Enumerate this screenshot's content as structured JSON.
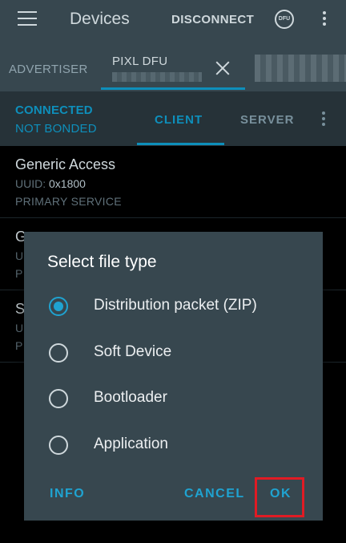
{
  "appbar": {
    "title": "Devices",
    "disconnect_label": "DISCONNECT",
    "dfu_icon_text": "DFU",
    "icons": [
      "menu-icon",
      "dfu-icon",
      "overflow-icon"
    ]
  },
  "tabs": {
    "advertiser_label": "ADVERTISER",
    "device_label": "PIXL DFU"
  },
  "status": {
    "connected": "CONNECTED",
    "bonded": "NOT BONDED",
    "client_tab": "CLIENT",
    "server_tab": "SERVER"
  },
  "services": [
    {
      "name": "Generic Access",
      "uuid_label": "UUID:",
      "uuid": "0x1800",
      "type": "PRIMARY SERVICE"
    },
    {
      "name": "G",
      "uuid_label": "U",
      "uuid": "",
      "type": "P"
    },
    {
      "name": "S",
      "uuid_label": "U",
      "uuid": "",
      "type": "P"
    }
  ],
  "dialog": {
    "title": "Select file type",
    "options": [
      {
        "label": "Distribution packet (ZIP)",
        "selected": true
      },
      {
        "label": "Soft Device",
        "selected": false
      },
      {
        "label": "Bootloader",
        "selected": false
      },
      {
        "label": "Application",
        "selected": false
      }
    ],
    "info_label": "INFO",
    "cancel_label": "CANCEL",
    "ok_label": "OK"
  },
  "colors": {
    "accent": "#1fa3d1",
    "appbar": "#37474f",
    "highlight": "#e01b24"
  }
}
